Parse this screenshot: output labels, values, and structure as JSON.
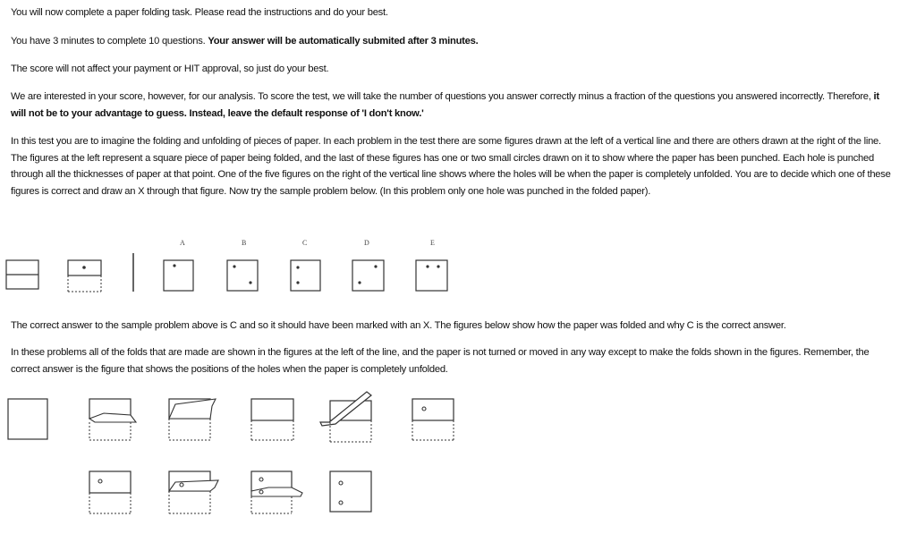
{
  "intro": {
    "line1": "You will now complete a paper folding task. Please read the instructions and do your best.",
    "line2_normal": "You have 3 minutes to complete 10 questions. ",
    "line2_bold": "Your answer will be automatically submited after 3 minutes.",
    "line3": "The score will not affect your payment or HIT approval, so just do your best.",
    "line4_normal": "We are interested in your score, however, for our analysis. To score the test, we will take the number of questions you answer correctly minus a fraction of the questions you answered incorrectly. Therefore, ",
    "line4_bold": "it will not be to your advantage to guess. Instead, leave the default response of 'I don't know.'"
  },
  "instructions": {
    "text": "In this test you are to imagine the folding and unfolding of pieces of paper. In each problem in the test there are some figures drawn at the left of a vertical line and there are others drawn at the right of the line. The figures at the left represent a square piece of paper being folded, and the last of these figures has one or two small circles drawn on it to show where the paper has been punched. Each hole is punched through all the thicknesses of paper at that point. One of the five figures on the right of the vertical line shows where the holes will be when the paper is completely unfolded. You are to decide which one of these figures is correct and draw an X through that figure. Now try the sample problem below. (In this problem only one hole was punched in the folded paper)."
  },
  "sample": {
    "option_labels": [
      "A",
      "B",
      "C",
      "D",
      "E"
    ]
  },
  "explanation": {
    "line1": "The correct answer to the sample problem above is C and so it should have been marked with an X. The figures below show how the paper was folded and why C is the correct answer.",
    "line2": "In these problems all of the folds that are made are shown in the figures at the left of the line, and the paper is not turned or moved in any way except to make the folds shown in the figures. Remember, the correct answer is the figure that shows the positions of the holes when the paper is completely unfolded."
  }
}
